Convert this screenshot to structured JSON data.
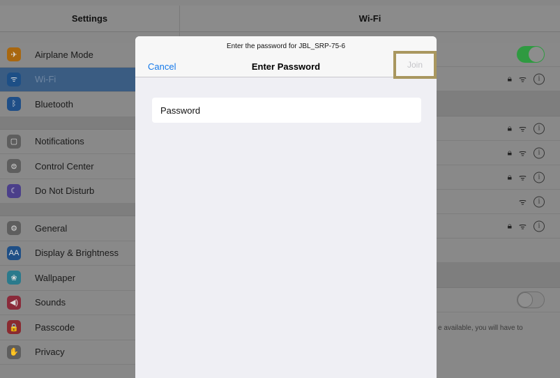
{
  "settings": {
    "title": "Settings",
    "groups": [
      [
        {
          "label": "Airplane Mode",
          "icon": "airplane-icon",
          "color": "#a8670f",
          "glyph": "✈",
          "selected": false
        },
        {
          "label": "Wi-Fi",
          "icon": "wifi-icon",
          "color": "#1d4f86",
          "glyph": "ᯤ",
          "selected": true
        },
        {
          "label": "Bluetooth",
          "icon": "bluetooth-icon",
          "color": "#1f4e87",
          "glyph": "ᛒ",
          "selected": false
        }
      ],
      [
        {
          "label": "Notifications",
          "icon": "notifications-icon",
          "color": "#5e5e5e",
          "glyph": "▢",
          "selected": false
        },
        {
          "label": "Control Center",
          "icon": "control-center-icon",
          "color": "#5e5e5e",
          "glyph": "⊜",
          "selected": false
        },
        {
          "label": "Do Not Disturb",
          "icon": "moon-icon",
          "color": "#4b3f8a",
          "glyph": "☾",
          "selected": false
        }
      ],
      [
        {
          "label": "General",
          "icon": "gear-icon",
          "color": "#5e5e5e",
          "glyph": "⚙",
          "selected": false
        },
        {
          "label": "Display & Brightness",
          "icon": "display-brightness-icon",
          "color": "#1f4f86",
          "glyph": "AA",
          "selected": false
        },
        {
          "label": "Wallpaper",
          "icon": "wallpaper-icon",
          "color": "#2a7a8c",
          "glyph": "❀",
          "selected": false
        },
        {
          "label": "Sounds",
          "icon": "speaker-icon",
          "color": "#8a2a3a",
          "glyph": "◀)",
          "selected": false
        },
        {
          "label": "Passcode",
          "icon": "lock-icon",
          "color": "#8a2a30",
          "glyph": "🔒",
          "selected": false
        },
        {
          "label": "Privacy",
          "icon": "hand-icon",
          "color": "#5e5e5e",
          "glyph": "✋",
          "selected": false
        }
      ]
    ]
  },
  "wifi": {
    "title": "Wi-Fi",
    "footnote": "e available, you will have to"
  },
  "dialog": {
    "prompt": "Enter the password for JBL_SRP-75-6",
    "title": "Enter Password",
    "cancel_label": "Cancel",
    "join_label": "Join",
    "password_placeholder": "Password"
  },
  "colors": {
    "accent": "#1479ea",
    "highlight_border": "#a9975f"
  }
}
